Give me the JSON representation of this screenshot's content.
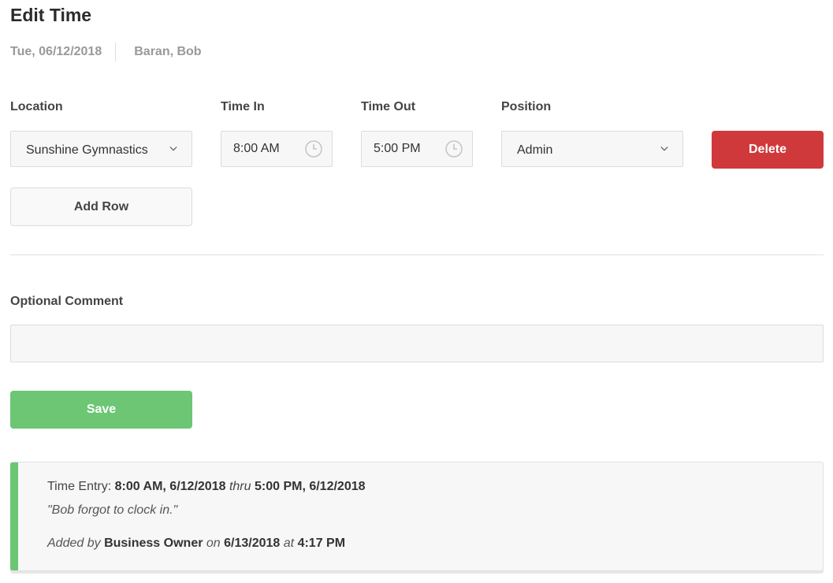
{
  "page": {
    "title": "Edit Time",
    "date": "Tue, 06/12/2018",
    "employee": "Baran, Bob"
  },
  "form": {
    "location_label": "Location",
    "location_value": "Sunshine Gymnastics",
    "time_in_label": "Time In",
    "time_in_value": "8:00 AM",
    "time_out_label": "Time Out",
    "time_out_value": "5:00 PM",
    "position_label": "Position",
    "position_value": "Admin",
    "delete_label": "Delete",
    "add_row_label": "Add Row",
    "comment_label": "Optional Comment",
    "comment_value": "",
    "save_label": "Save"
  },
  "history": {
    "entry_prefix": "Time Entry:",
    "entry_start": "8:00 AM, 6/12/2018",
    "entry_thru": "thru",
    "entry_end": "5:00 PM, 6/12/2018",
    "comment": "\"Bob forgot to clock in.\"",
    "added_by_prefix": "Added by",
    "added_by": "Business Owner",
    "on_word": "on",
    "added_date": "6/13/2018",
    "at_word": "at",
    "added_time": "4:17 PM"
  },
  "colors": {
    "delete": "#d0393c",
    "save": "#6cc673",
    "accent": "#6cc673"
  },
  "icons": {
    "dropdown": "chevron-down-icon",
    "time": "clock-icon"
  }
}
